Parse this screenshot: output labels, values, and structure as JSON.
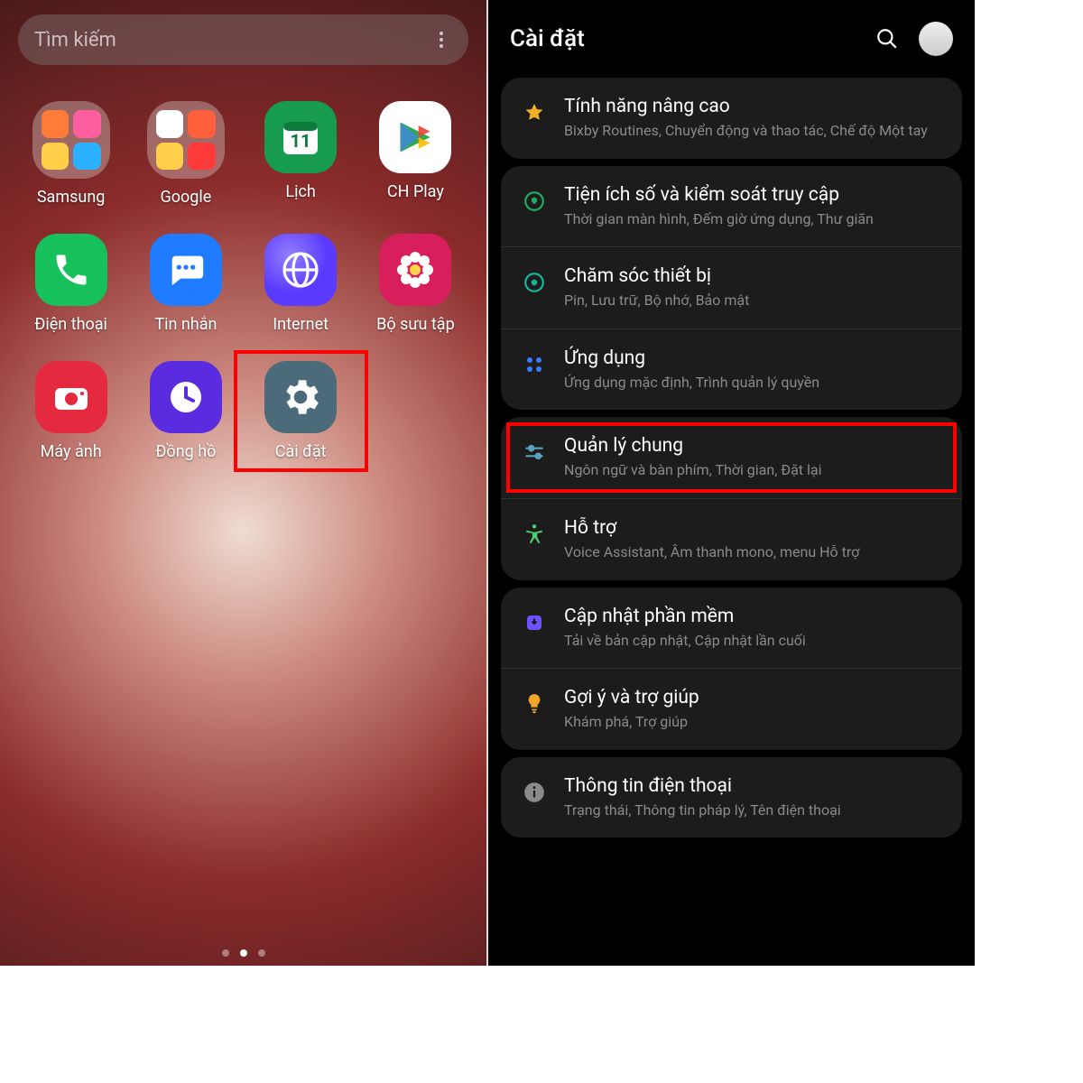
{
  "left": {
    "search_placeholder": "Tìm kiếm",
    "apps": [
      {
        "label": "Samsung",
        "type": "folder",
        "colors": [
          "#ff7b3a",
          "#ff5f9e",
          "#ffcf4a",
          "#2bb1ff"
        ]
      },
      {
        "label": "Google",
        "type": "folder",
        "colors": [
          "#fff",
          "#ff5f3a",
          "#ffcf4a",
          "#ff3a3a"
        ]
      },
      {
        "label": "Lịch",
        "type": "calendar",
        "bg": "#179b4f",
        "num": "11"
      },
      {
        "label": "CH Play",
        "type": "play",
        "bg": "#ffffff"
      },
      {
        "label": "Điện thoại",
        "type": "phone",
        "bg": "#16c05a"
      },
      {
        "label": "Tin nhắn",
        "type": "chat",
        "bg": "#1f7bff"
      },
      {
        "label": "Internet",
        "type": "globe",
        "bg": "#5a3aff"
      },
      {
        "label": "Bộ sưu tập",
        "type": "flower",
        "bg": "#d81e5b"
      },
      {
        "label": "Máy ảnh",
        "type": "camera",
        "bg": "#e52a3f"
      },
      {
        "label": "Đồng hồ",
        "type": "clock",
        "bg": "#5b2be0"
      },
      {
        "label": "Cài đặt",
        "type": "gear",
        "bg": "#4c6b7a",
        "highlight": true
      }
    ],
    "pager_index": 1,
    "pager_count": 3
  },
  "right": {
    "title": "Cài đặt",
    "groups": [
      {
        "rows": [
          {
            "icon": "star",
            "color": "#f2b027",
            "title": "Tính năng nâng cao",
            "sub": "Bixby Routines, Chuyển động và thao tác, Chế độ Một tay"
          }
        ]
      },
      {
        "rows": [
          {
            "icon": "wellbeing",
            "color": "#1fae5e",
            "title": "Tiện ích số và kiểm soát truy cập",
            "sub": "Thời gian màn hình, Đếm giờ ứng dụng, Thư giãn"
          },
          {
            "icon": "care",
            "color": "#14b99b",
            "title": "Chăm sóc thiết bị",
            "sub": "Pin, Lưu trữ, Bộ nhớ, Bảo mật"
          },
          {
            "icon": "apps",
            "color": "#3a7bff",
            "title": "Ứng dụng",
            "sub": "Ứng dụng mặc định, Trình quản lý quyền"
          }
        ]
      },
      {
        "rows": [
          {
            "icon": "sliders",
            "color": "#5aa0c0",
            "title": "Quản lý chung",
            "sub": "Ngôn ngữ và bàn phím, Thời gian, Đặt lại",
            "highlight": true
          },
          {
            "icon": "a11y",
            "color": "#4bcf6d",
            "title": "Hỗ trợ",
            "sub": "Voice Assistant, Âm thanh mono, menu Hỗ trợ"
          }
        ]
      },
      {
        "rows": [
          {
            "icon": "update",
            "color": "#6f52ff",
            "title": "Cập nhật phần mềm",
            "sub": "Tải về bản cập nhật, Cập nhật lần cuối"
          },
          {
            "icon": "bulb",
            "color": "#f2a627",
            "title": "Gợi ý và trợ giúp",
            "sub": "Khám phá, Trợ giúp"
          }
        ]
      },
      {
        "rows": [
          {
            "icon": "info",
            "color": "#8a8a8a",
            "title": "Thông tin điện thoại",
            "sub": "Trạng thái, Thông tin pháp lý, Tên điện thoại"
          }
        ]
      }
    ]
  }
}
